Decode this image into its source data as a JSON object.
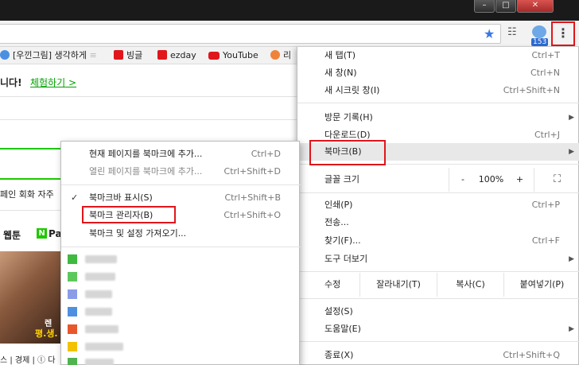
{
  "window": {
    "minimize_glyph": "–",
    "maximize_glyph": "□",
    "close_glyph": "✕"
  },
  "toolbar": {
    "bookmark_star_icon": "star-icon",
    "extension_badge": "153",
    "menu_glyph": "⋮"
  },
  "bookmarks_bar": [
    {
      "label": "[우낀그림] 생각하게",
      "color": "#4a90e2"
    },
    {
      "label": "빙글",
      "color": "#e0161b"
    },
    {
      "label": "ezday",
      "color": "#e0161b"
    },
    {
      "label": "YouTube",
      "color": "#e0161b"
    },
    {
      "label": "리",
      "color": "#f0833a"
    }
  ],
  "page": {
    "promo_text": "니다!",
    "promo_link": "체험하기",
    "promo_chevron": ">",
    "phrase_text": "페인 회화 자주",
    "nav_webtoon": "웹툰",
    "nav_n": "N",
    "nav_pay": "Pa",
    "photo_text1": "렌",
    "photo_text2": "평.생.",
    "news_line": "스 | 경제 | ⓛ 다"
  },
  "main_menu": {
    "items": [
      {
        "label": "새 탭(T)",
        "shortcut": "Ctrl+T"
      },
      {
        "label": "새 창(N)",
        "shortcut": "Ctrl+N"
      },
      {
        "label": "새 시크릿 창(I)",
        "shortcut": "Ctrl+Shift+N"
      },
      {
        "label": "방문 기록(H)",
        "shortcut": ""
      },
      {
        "label": "다운로드(D)",
        "shortcut": "Ctrl+J"
      },
      {
        "label": "북마크(B)",
        "shortcut": ""
      },
      {
        "label": "인쇄(P)",
        "shortcut": "Ctrl+P"
      },
      {
        "label": "전송...",
        "shortcut": ""
      },
      {
        "label": "찾기(F)...",
        "shortcut": "Ctrl+F"
      },
      {
        "label": "도구 더보기",
        "shortcut": ""
      },
      {
        "label": "설정(S)",
        "shortcut": ""
      },
      {
        "label": "도움말(E)",
        "shortcut": ""
      },
      {
        "label": "종료(X)",
        "shortcut": "Ctrl+Shift+Q"
      }
    ],
    "zoom": {
      "label": "글꼴 크기",
      "minus": "-",
      "value": "100%",
      "plus": "+",
      "fullscreen_icon": "fullscreen-icon"
    },
    "edit": {
      "label": "수정",
      "cut": "잘라내기(T)",
      "copy": "복사(C)",
      "paste": "붙여넣기(P)"
    },
    "submenu_arrow": "▶"
  },
  "bookmark_submenu": {
    "items": [
      {
        "label": "현재 페이지를 북마크에 추가...",
        "shortcut": "Ctrl+D"
      },
      {
        "label": "열린 페이지를 북마크에 추가...",
        "shortcut": "Ctrl+Shift+D"
      },
      {
        "label": "북마크바 표시(S)",
        "shortcut": "Ctrl+Shift+B"
      },
      {
        "label": "북마크 관리자(B)",
        "shortcut": "Ctrl+Shift+O"
      },
      {
        "label": "북마크 및 설정 가져오기...",
        "shortcut": ""
      }
    ],
    "check_glyph": "✓",
    "blurred_bookmarks": [
      {
        "color": "#3fb93f"
      },
      {
        "color": "#5cc85c"
      },
      {
        "color": "#8a9ce8"
      },
      {
        "color": "#4f8fe0"
      },
      {
        "color": "#e8572b"
      },
      {
        "color": "#f2c200"
      },
      {
        "color": "#4fb34f"
      }
    ]
  }
}
